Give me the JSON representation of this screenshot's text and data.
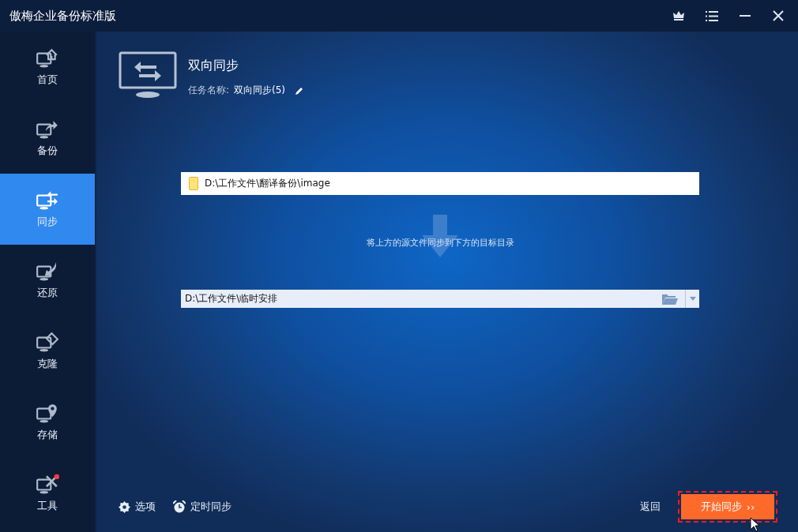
{
  "window": {
    "title": "傲梅企业备份标准版"
  },
  "sidebar": {
    "items": [
      {
        "label": "首页",
        "kind": "home",
        "selected": false
      },
      {
        "label": "备份",
        "kind": "backup",
        "selected": false
      },
      {
        "label": "同步",
        "kind": "sync",
        "selected": true
      },
      {
        "label": "还原",
        "kind": "restore",
        "selected": false
      },
      {
        "label": "克隆",
        "kind": "clone",
        "selected": false
      },
      {
        "label": "存储",
        "kind": "storage",
        "selected": false
      },
      {
        "label": "工具",
        "kind": "tools",
        "selected": false
      }
    ]
  },
  "header": {
    "title": "双向同步",
    "task_name_label": "任务名称:",
    "task_name": "双向同步(5)"
  },
  "source": {
    "path": "D:\\工作文件\\翻译备份\\image"
  },
  "hint": "将上方的源文件同步到下方的目标目录",
  "destination": {
    "path": "D:\\工作文件\\临时安排"
  },
  "footer": {
    "options": "选项",
    "schedule": "定时同步",
    "back": "返回",
    "start": "开始同步",
    "start_chevrons": "››"
  }
}
